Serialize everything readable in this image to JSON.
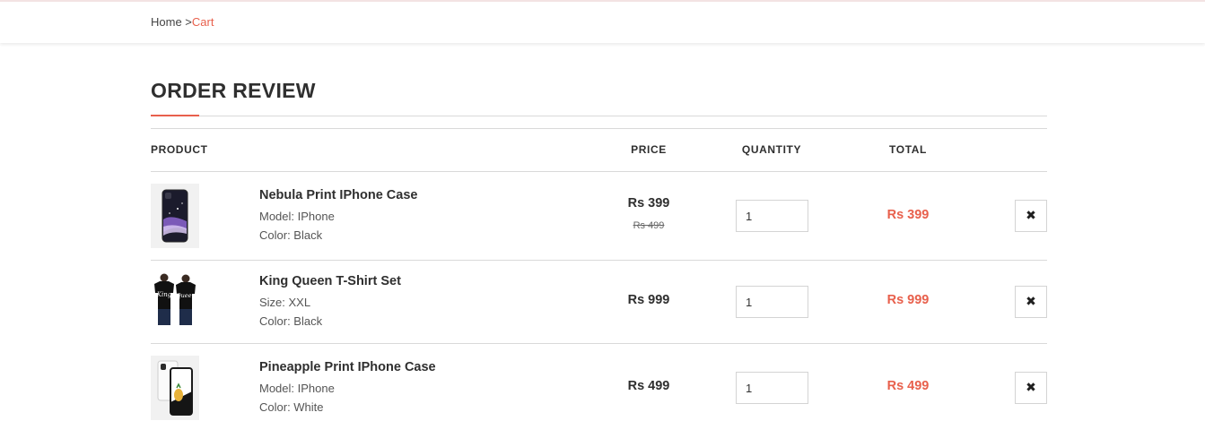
{
  "breadcrumb": {
    "home": "Home >",
    "current": "Cart"
  },
  "page_title": "ORDER REVIEW",
  "columns": {
    "product": "PRODUCT",
    "price": "PRICE",
    "quantity": "QUANTITY",
    "total": "TOTAL"
  },
  "remove_glyph": "✖",
  "accent_color": "#e8604c",
  "items": [
    {
      "name": "Nebula Print IPhone Case",
      "attr1": "Model: IPhone",
      "attr2": "Color: Black",
      "price": "Rs 399",
      "old_price": "Rs 499",
      "quantity": "1",
      "total": "Rs 399",
      "thumbnail_icon": "phone-case-nebula"
    },
    {
      "name": "King Queen T-Shirt Set",
      "attr1": "Size: XXL",
      "attr2": "Color: Black",
      "price": "Rs 999",
      "old_price": "",
      "quantity": "1",
      "total": "Rs 999",
      "thumbnail_icon": "tshirt-pair"
    },
    {
      "name": "Pineapple Print IPhone Case",
      "attr1": "Model: IPhone",
      "attr2": "Color: White",
      "price": "Rs 499",
      "old_price": "",
      "quantity": "1",
      "total": "Rs 499",
      "thumbnail_icon": "phone-case-pineapple"
    }
  ]
}
